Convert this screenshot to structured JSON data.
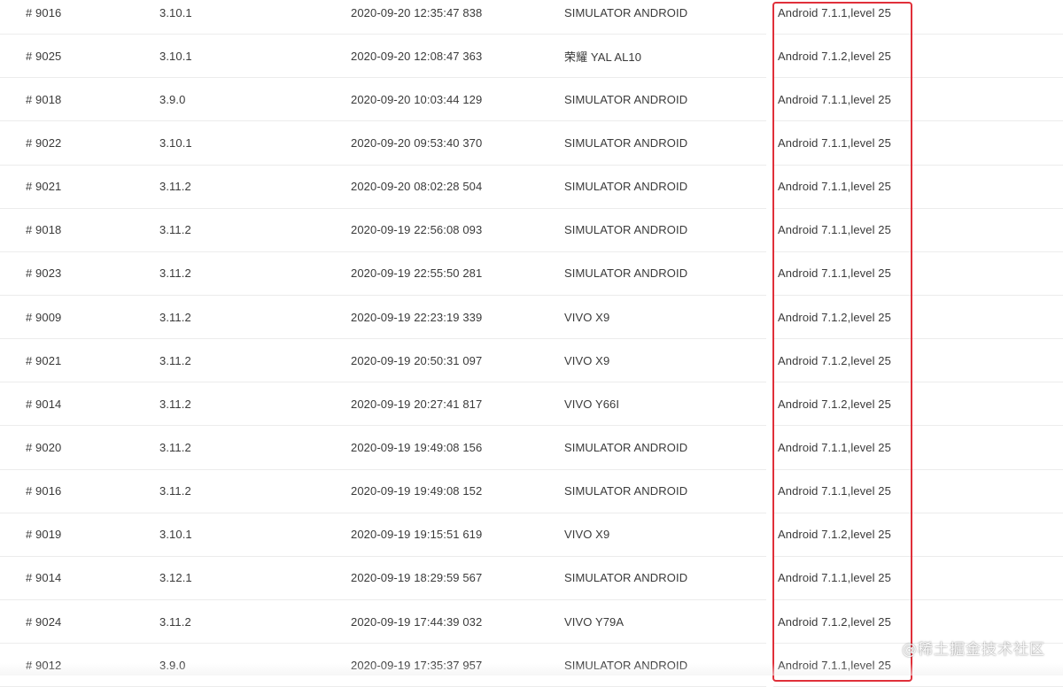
{
  "colors": {
    "highlight_border": "#e0303a",
    "row_divider": "#ececec",
    "text": "#3a3a3a"
  },
  "rows": [
    {
      "id": "# 9016",
      "version": "3.10.1",
      "time": "2020-09-20 12:35:47 838",
      "device": "SIMULATOR ANDROID",
      "os": "Android 7.1.1,level 25"
    },
    {
      "id": "# 9025",
      "version": "3.10.1",
      "time": "2020-09-20 12:08:47 363",
      "device": "荣耀 YAL AL10",
      "os": "Android 7.1.2,level 25"
    },
    {
      "id": "# 9018",
      "version": "3.9.0",
      "time": "2020-09-20 10:03:44 129",
      "device": "SIMULATOR ANDROID",
      "os": "Android 7.1.1,level 25"
    },
    {
      "id": "# 9022",
      "version": "3.10.1",
      "time": "2020-09-20 09:53:40 370",
      "device": "SIMULATOR ANDROID",
      "os": "Android 7.1.1,level 25"
    },
    {
      "id": "# 9021",
      "version": "3.11.2",
      "time": "2020-09-20 08:02:28 504",
      "device": "SIMULATOR ANDROID",
      "os": "Android 7.1.1,level 25"
    },
    {
      "id": "# 9018",
      "version": "3.11.2",
      "time": "2020-09-19 22:56:08 093",
      "device": "SIMULATOR ANDROID",
      "os": "Android 7.1.1,level 25"
    },
    {
      "id": "# 9023",
      "version": "3.11.2",
      "time": "2020-09-19 22:55:50 281",
      "device": "SIMULATOR ANDROID",
      "os": "Android 7.1.1,level 25"
    },
    {
      "id": "# 9009",
      "version": "3.11.2",
      "time": "2020-09-19 22:23:19 339",
      "device": "VIVO X9",
      "os": "Android 7.1.2,level 25"
    },
    {
      "id": "# 9021",
      "version": "3.11.2",
      "time": "2020-09-19 20:50:31 097",
      "device": "VIVO X9",
      "os": "Android 7.1.2,level 25"
    },
    {
      "id": "# 9014",
      "version": "3.11.2",
      "time": "2020-09-19 20:27:41 817",
      "device": "VIVO Y66I",
      "os": "Android 7.1.2,level 25"
    },
    {
      "id": "# 9020",
      "version": "3.11.2",
      "time": "2020-09-19 19:49:08 156",
      "device": "SIMULATOR ANDROID",
      "os": "Android 7.1.1,level 25"
    },
    {
      "id": "# 9016",
      "version": "3.11.2",
      "time": "2020-09-19 19:49:08 152",
      "device": "SIMULATOR ANDROID",
      "os": "Android 7.1.1,level 25"
    },
    {
      "id": "# 9019",
      "version": "3.10.1",
      "time": "2020-09-19 19:15:51 619",
      "device": "VIVO X9",
      "os": "Android 7.1.2,level 25"
    },
    {
      "id": "# 9014",
      "version": "3.12.1",
      "time": "2020-09-19 18:29:59 567",
      "device": "SIMULATOR ANDROID",
      "os": "Android 7.1.1,level 25"
    },
    {
      "id": "# 9024",
      "version": "3.11.2",
      "time": "2020-09-19 17:44:39 032",
      "device": "VIVO Y79A",
      "os": "Android 7.1.2,level 25"
    },
    {
      "id": "# 9012",
      "version": "3.9.0",
      "time": "2020-09-19 17:35:37 957",
      "device": "SIMULATOR ANDROID",
      "os": "Android 7.1.1,level 25"
    }
  ],
  "watermark": "@稀土掘金技术社区"
}
